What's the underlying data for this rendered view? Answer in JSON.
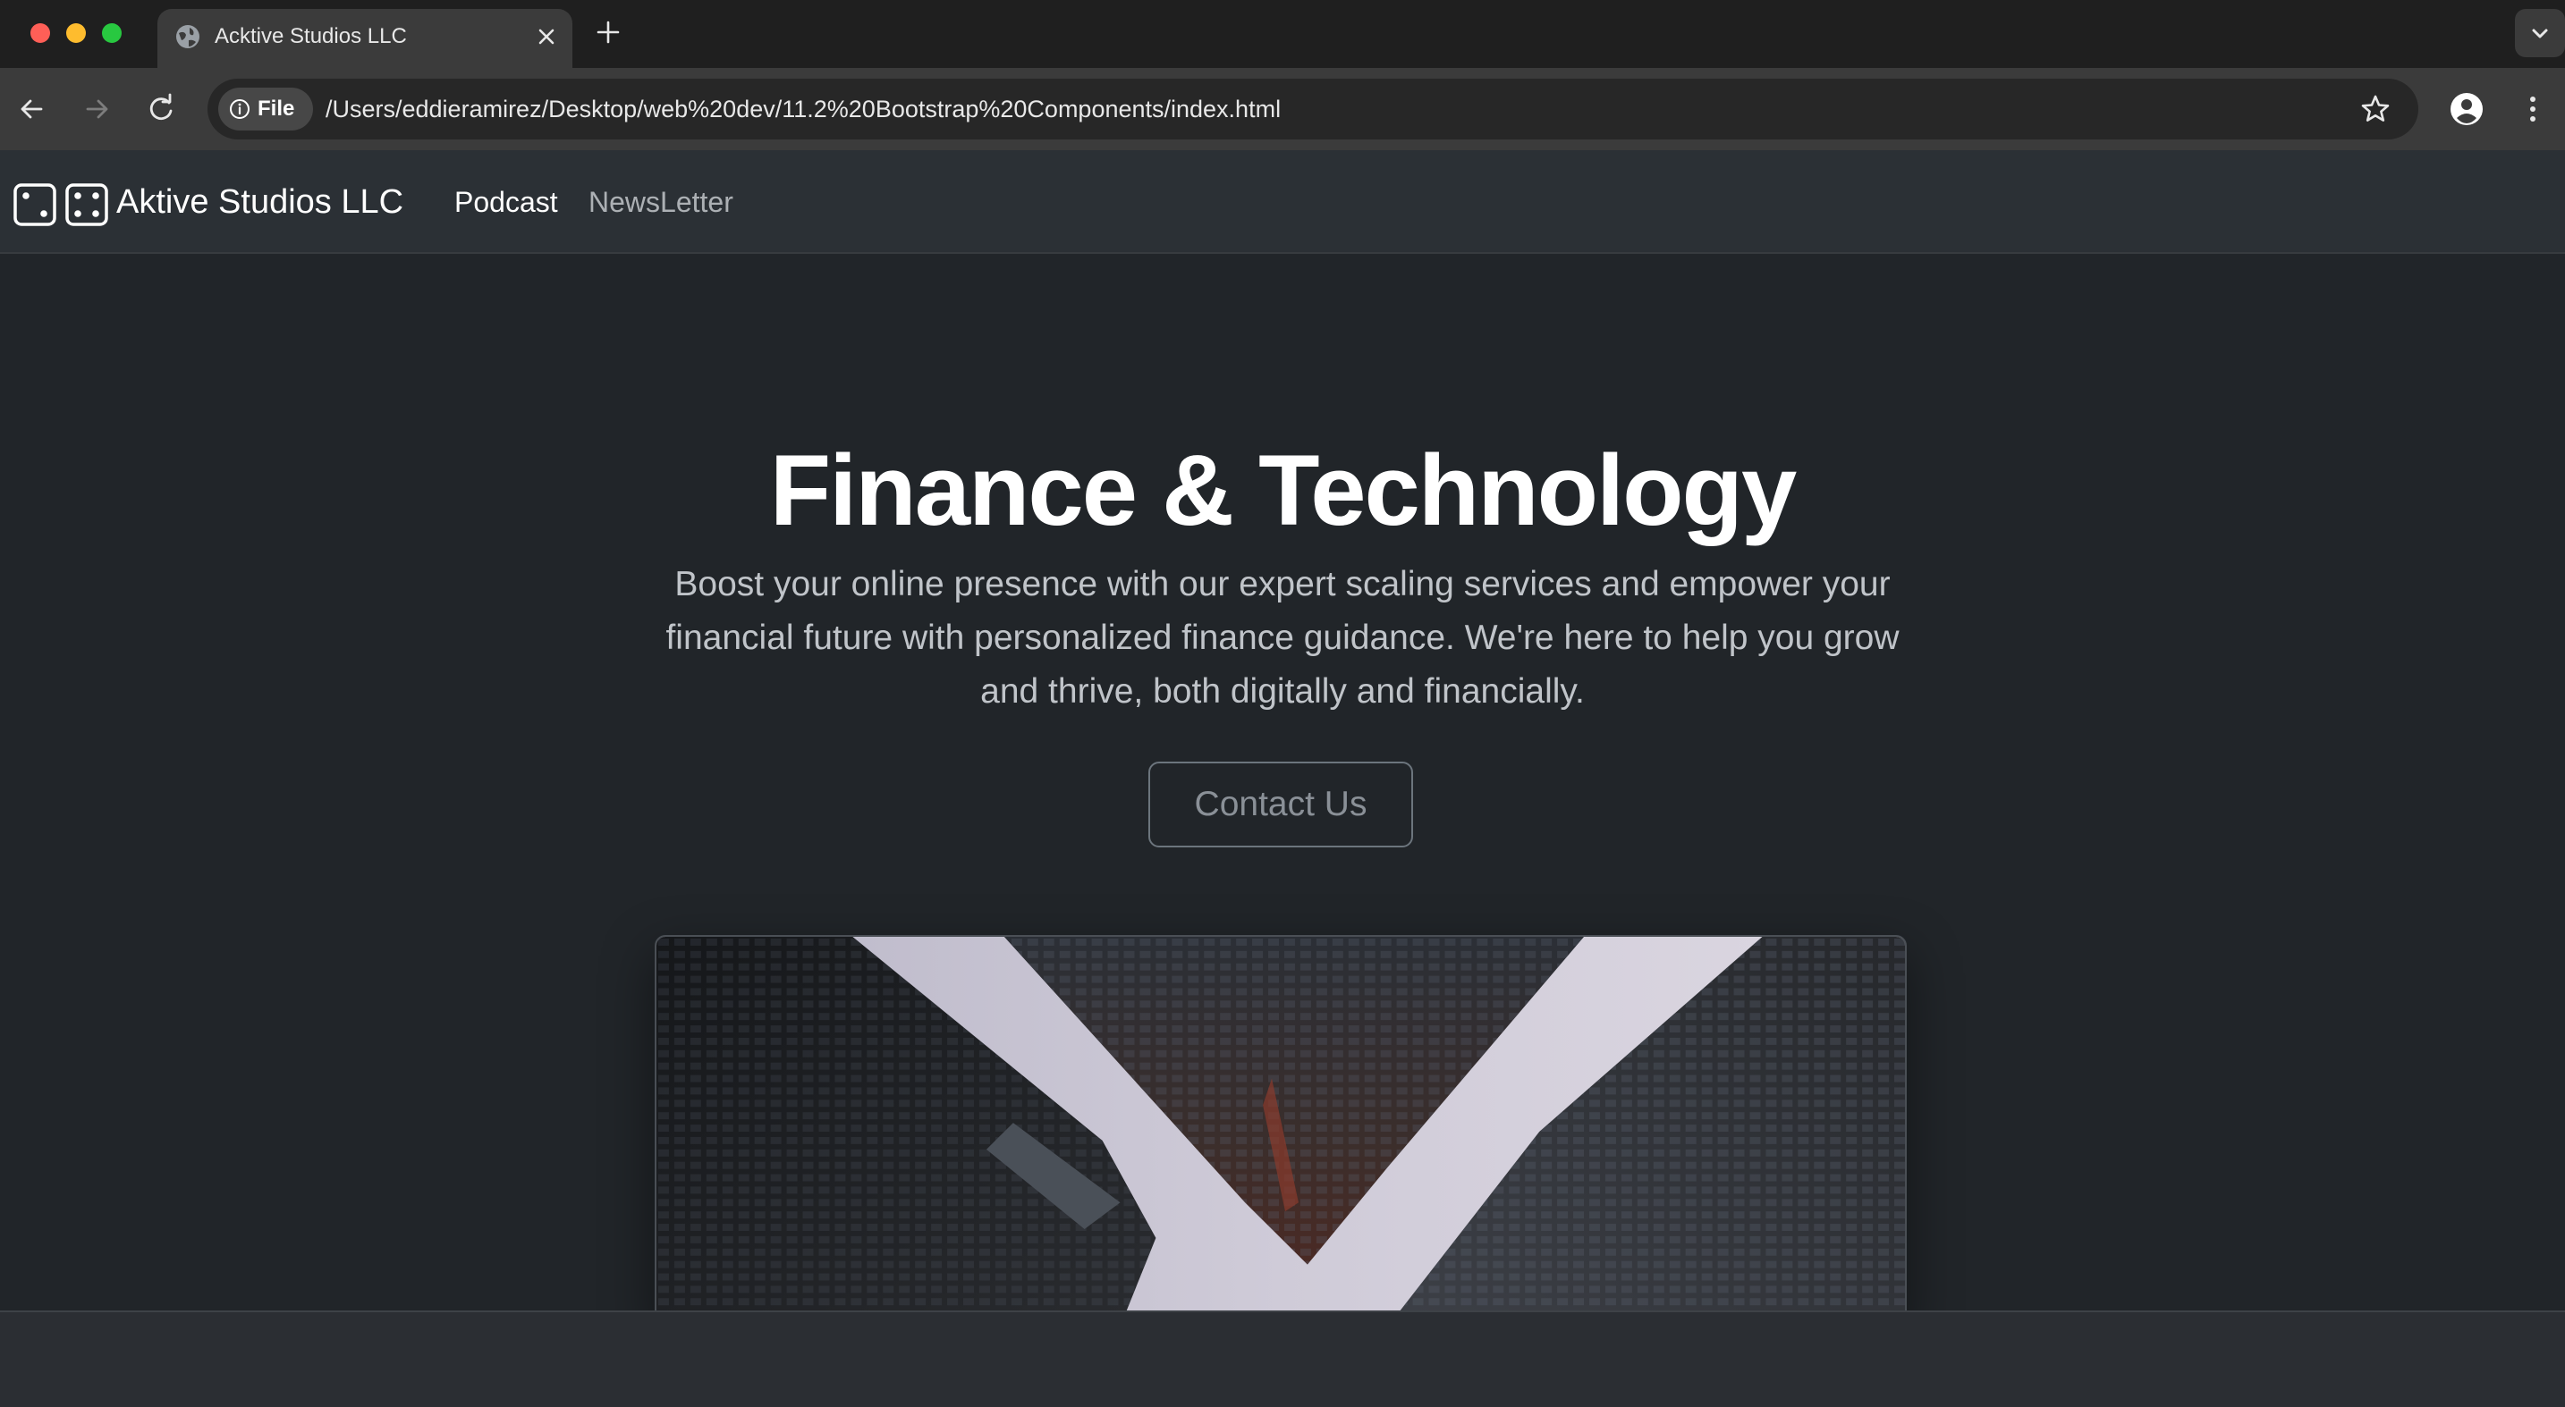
{
  "browser": {
    "tab": {
      "title": "Acktive Studios LLC",
      "icon": "globe-icon"
    },
    "omnibox": {
      "chip_label": "File",
      "url": "/Users/eddieramirez/Desktop/web%20dev/11.2%20Bootstrap%20Components/index.html"
    }
  },
  "navbar": {
    "brand": "Aktive Studios LLC",
    "links": [
      {
        "label": "Podcast",
        "active": true
      },
      {
        "label": "NewsLetter",
        "active": false
      }
    ]
  },
  "hero": {
    "title": "Finance & Technology",
    "lead": "Boost your online presence with our expert scaling services and empower your financial future with personalized finance guidance. We're here to help you grow and thrive, both digitally and financially.",
    "cta_label": "Contact Us",
    "image_icon": "skyscrapers-photo"
  },
  "colors": {
    "page_bg": "#212529",
    "navbar_bg": "#2b3035",
    "browser_chrome": "#3b3b3b"
  }
}
